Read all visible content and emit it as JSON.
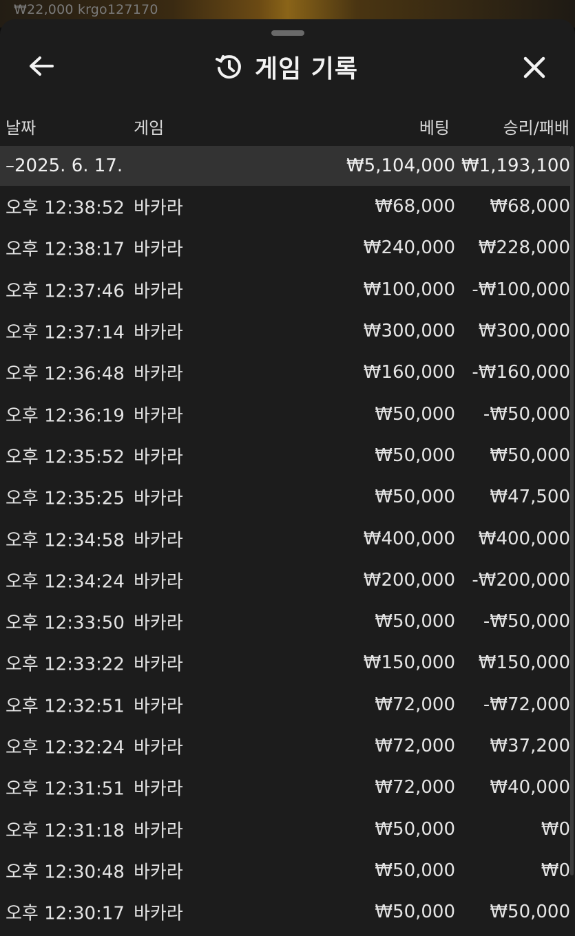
{
  "backdrop": {
    "text": "₩22,000  krgo127170"
  },
  "header": {
    "title": "게임 기록",
    "back_icon": "arrow-left-icon",
    "history_icon": "history-icon",
    "close_icon": "close-icon"
  },
  "columns": {
    "date": "날짜",
    "game": "게임",
    "bet": "베팅",
    "result": "승리/패배"
  },
  "date_group": {
    "label": "–2025. 6. 17.",
    "total_bet": "₩5,104,000",
    "total_result": "₩1,193,100"
  },
  "rows": [
    {
      "time": "오후 12:38:52",
      "game": "바카라",
      "bet": "₩68,000",
      "result": "₩68,000"
    },
    {
      "time": "오후 12:38:17",
      "game": "바카라",
      "bet": "₩240,000",
      "result": "₩228,000"
    },
    {
      "time": "오후 12:37:46",
      "game": "바카라",
      "bet": "₩100,000",
      "result": "-₩100,000"
    },
    {
      "time": "오후 12:37:14",
      "game": "바카라",
      "bet": "₩300,000",
      "result": "₩300,000"
    },
    {
      "time": "오후 12:36:48",
      "game": "바카라",
      "bet": "₩160,000",
      "result": "-₩160,000"
    },
    {
      "time": "오후 12:36:19",
      "game": "바카라",
      "bet": "₩50,000",
      "result": "-₩50,000"
    },
    {
      "time": "오후 12:35:52",
      "game": "바카라",
      "bet": "₩50,000",
      "result": "₩50,000"
    },
    {
      "time": "오후 12:35:25",
      "game": "바카라",
      "bet": "₩50,000",
      "result": "₩47,500"
    },
    {
      "time": "오후 12:34:58",
      "game": "바카라",
      "bet": "₩400,000",
      "result": "₩400,000"
    },
    {
      "time": "오후 12:34:24",
      "game": "바카라",
      "bet": "₩200,000",
      "result": "-₩200,000"
    },
    {
      "time": "오후 12:33:50",
      "game": "바카라",
      "bet": "₩50,000",
      "result": "-₩50,000"
    },
    {
      "time": "오후 12:33:22",
      "game": "바카라",
      "bet": "₩150,000",
      "result": "₩150,000"
    },
    {
      "time": "오후 12:32:51",
      "game": "바카라",
      "bet": "₩72,000",
      "result": "-₩72,000"
    },
    {
      "time": "오후 12:32:24",
      "game": "바카라",
      "bet": "₩72,000",
      "result": "₩37,200"
    },
    {
      "time": "오후 12:31:51",
      "game": "바카라",
      "bet": "₩72,000",
      "result": "₩40,000"
    },
    {
      "time": "오후 12:31:18",
      "game": "바카라",
      "bet": "₩50,000",
      "result": "₩0"
    },
    {
      "time": "오후 12:30:48",
      "game": "바카라",
      "bet": "₩50,000",
      "result": "₩0"
    },
    {
      "time": "오후 12:30:17",
      "game": "바카라",
      "bet": "₩50,000",
      "result": "₩50,000"
    }
  ]
}
